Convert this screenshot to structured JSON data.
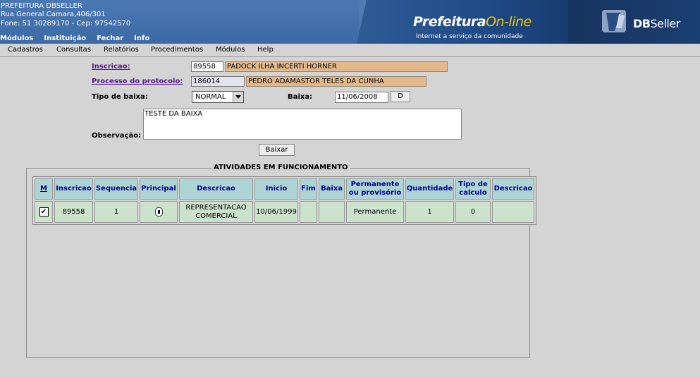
{
  "header": {
    "org_name": "PREFEITURA DBSELLER",
    "address": "Rua General Camara,406/301",
    "contact": "Fone: 51 30289170  -  Cep: 97542570",
    "top_menu": [
      "Módulos",
      "Instituição",
      "Fechar",
      "Info"
    ],
    "logo_main": "Prefeitura",
    "logo_online": "On-line",
    "logo_tagline": "Internet a serviço da comunidade",
    "brand_db": "DB",
    "brand_seller": "Seller"
  },
  "menubar": [
    "Cadastros",
    "Consultas",
    "Relatórios",
    "Procedimentos",
    "Módulos",
    "Help"
  ],
  "form": {
    "inscricao_label": "Inscricao:",
    "inscricao_value": "89558",
    "inscricao_name": "PADOCK ILHA INCERTI HORNER",
    "protocolo_label": "Processo do protocolo:",
    "protocolo_value": "186014",
    "protocolo_name": "PEDRO ADAMASTOR TELES DA CUNHA",
    "tipo_label": "Tipo de baixa:",
    "tipo_value": "NORMAL",
    "baixa_label": "Baixa:",
    "baixa_value": "11/06/2008",
    "date_button": "D",
    "obs_label": "Observação:",
    "obs_value": "TESTE DA BAIXA",
    "submit_label": "Baixar"
  },
  "activities": {
    "legend": "ATIVIDADES EM FUNCIONAMENTO",
    "columns": [
      "M",
      "Inscricao",
      "Sequencia",
      "Principal",
      "Descricao",
      "Inicio",
      "Fim",
      "Baixa",
      "Permanente ou provisório",
      "Quantidade",
      "Tipo de calculo",
      "Descricao"
    ],
    "rows": [
      {
        "checked": "✔",
        "inscricao": "89558",
        "sequencia": "1",
        "principal": "selected",
        "descricao": "REPRESENTACAO COMERCIAL",
        "inicio": "10/06/1999",
        "fim": "",
        "baixa": "",
        "permanente": "Permanente",
        "quantidade": "1",
        "tipo_calculo": "0",
        "descricao2": ""
      }
    ]
  },
  "colors": {
    "banner": "#4f7bb3",
    "header_cell": "#add5d5",
    "data_cell": "#cde2cd",
    "name_field": "#e3b98b",
    "link": "#551a8b"
  }
}
